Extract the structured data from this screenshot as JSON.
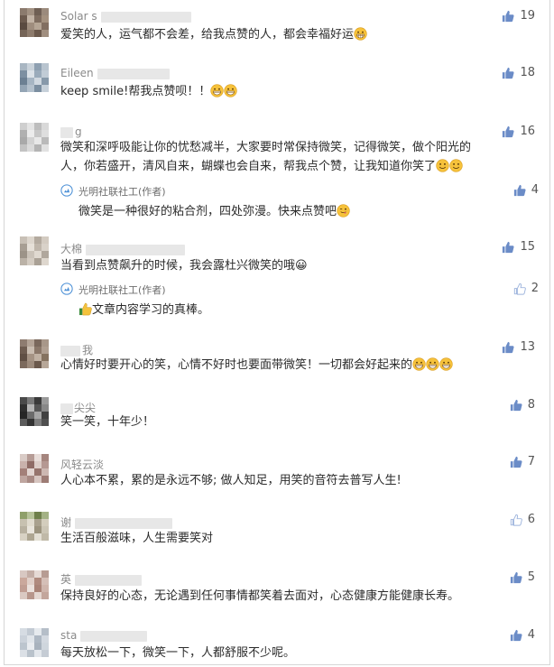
{
  "colors": {
    "like_filled": "#6b8cc7",
    "like_outline": "#9fb5dd",
    "badge_blue": "#4a8fd6"
  },
  "comments": [
    {
      "name": "Solar s",
      "text": "爱笑的人，运气都不会差，给我点赞的人，都会幸福好运",
      "emoji": "grinning-face",
      "likes": "19",
      "like_icon": "thumbs-up-filled"
    },
    {
      "name": "Eileen",
      "text": "keep smile!帮我点赞呗！！",
      "emoji": "grinning-face",
      "likes": "18",
      "like_icon": "thumbs-up-filled"
    },
    {
      "name": "g",
      "text_lines": [
        "微笑和深呼吸能让你的忧愁减半，大家要时常保持微笑，记得微笑，做个阳光的",
        "人，你若盛开，清风自来，蝴蝶也会自来，帮我点个赞，让我知道你笑了"
      ],
      "emoji": "slightly-smiling-face",
      "likes": "16",
      "like_icon": "thumbs-up-filled",
      "reply": {
        "name": "光明社联社工(作者)",
        "text": "微笑是一种很好的粘合剂，四处弥漫。快来点赞吧",
        "emoji": "winking-tongue-face",
        "likes": "4",
        "like_icon": "thumbs-up-filled"
      }
    },
    {
      "name": "大棉",
      "text": "当看到点赞飙升的时候，我会露杜兴微笑的哦😀",
      "likes": "15",
      "like_icon": "thumbs-up-filled",
      "reply": {
        "name": "光明社联社工(作者)",
        "text": "文章内容学习的真棒。",
        "emoji": "thumbs-up",
        "likes": "2",
        "like_icon": "thumbs-up-outline"
      }
    },
    {
      "name": "我",
      "text": "心情好时要开心的笑，心情不好时也要面带微笑！一切都会好起来的",
      "emoji": "grinning-face",
      "likes": "13",
      "like_icon": "thumbs-up-filled"
    },
    {
      "name": "尖尖",
      "text": "笑一笑，十年少！",
      "likes": "8",
      "like_icon": "thumbs-up-filled"
    },
    {
      "name": "风轻云淡",
      "text": "人心本不累，累的是永远不够; 做人知足，用笑的音符去普写人生!",
      "likes": "7",
      "like_icon": "thumbs-up-filled"
    },
    {
      "name": "谢",
      "text": "生活百般滋味，人生需要笑对",
      "likes": "6",
      "like_icon": "thumbs-up-outline"
    },
    {
      "name": "英",
      "text": "保持良好的心态，无论遇到任何事情都笑着去面对，心态健康方能健康长寿。",
      "likes": "5",
      "like_icon": "thumbs-up-filled"
    },
    {
      "name": "sta",
      "text": "每天放松一下，微笑一下，人都舒服不少呢。",
      "likes": "4",
      "like_icon": "thumbs-up-filled"
    }
  ]
}
